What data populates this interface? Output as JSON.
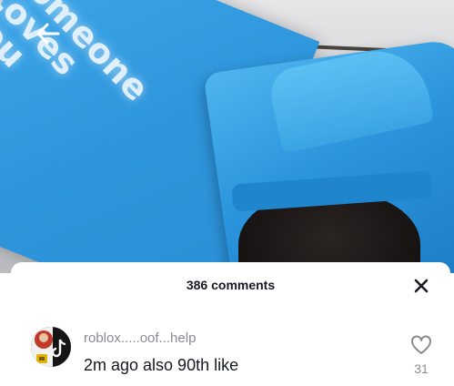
{
  "video": {
    "card_text": "Someone\nLoves\nYou"
  },
  "comments_panel": {
    "count_label": "386 comments"
  },
  "comments": [
    {
      "username": "roblox.....oof...help",
      "text": "2m ago also 90th like",
      "likes": "31"
    }
  ],
  "colors": {
    "card_blue": "#2f97dd",
    "text_primary": "#161823",
    "text_secondary": "#8a8b91"
  },
  "icons": {
    "back": "back-arrow-icon",
    "close": "close-icon",
    "like": "heart-outline-icon"
  }
}
